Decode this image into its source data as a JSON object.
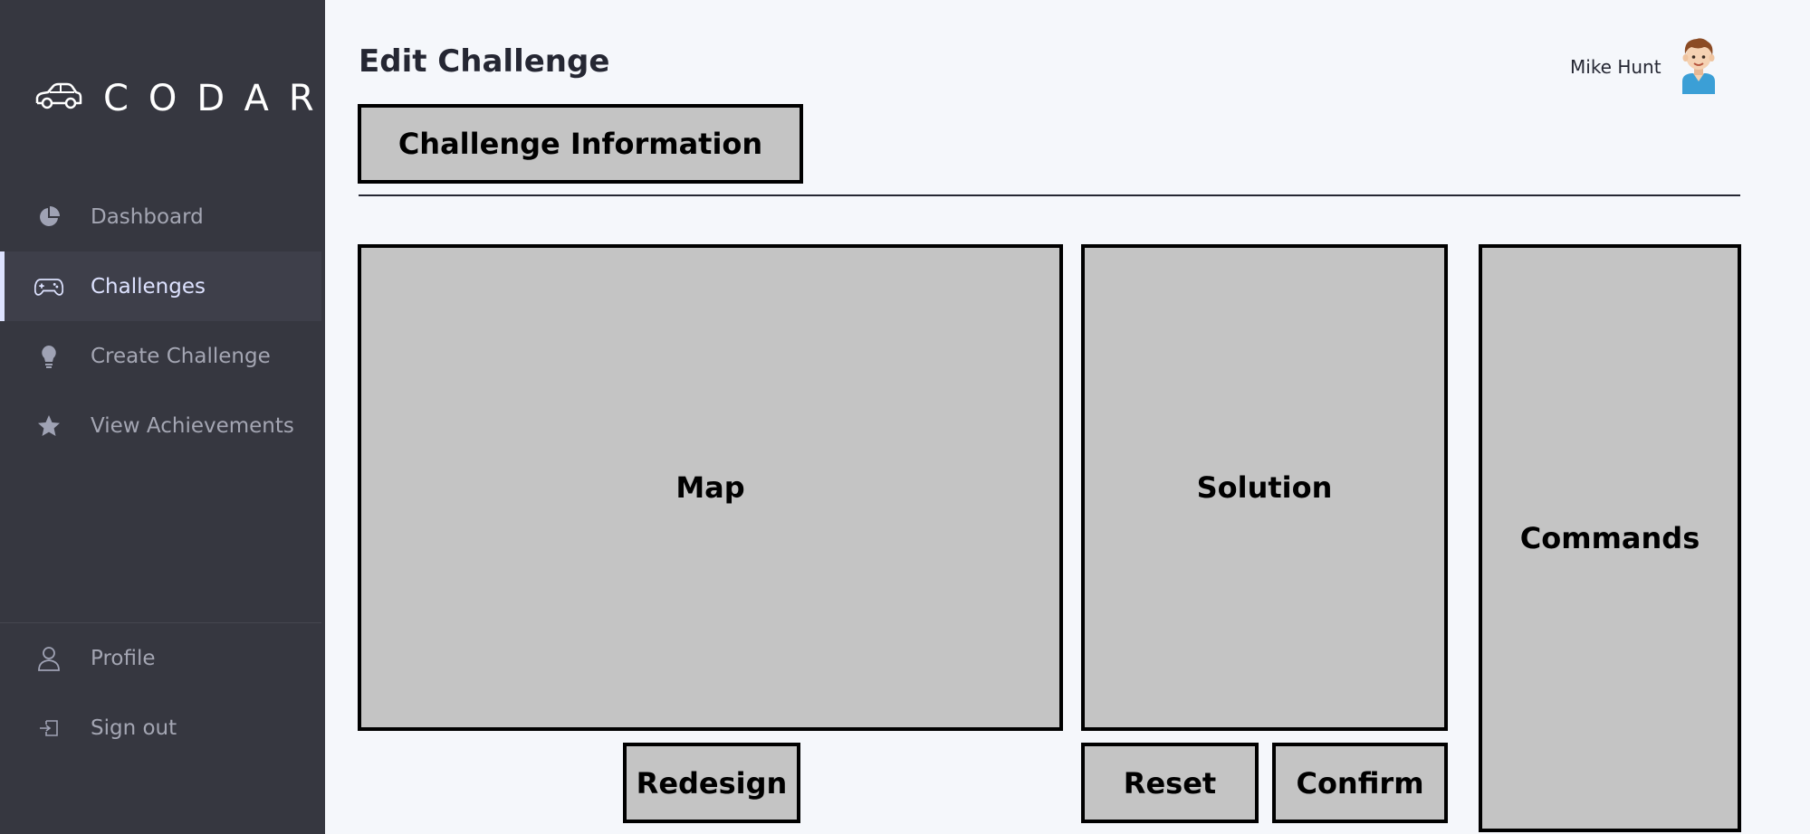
{
  "brand": {
    "name": "CODAR",
    "logo_icon": "car-icon"
  },
  "sidebar": {
    "items": [
      {
        "label": "Dashboard",
        "icon": "pie-chart-icon",
        "active": false
      },
      {
        "label": "Challenges",
        "icon": "gamepad-icon",
        "active": true
      },
      {
        "label": "Create Challenge",
        "icon": "lightbulb-icon",
        "active": false
      },
      {
        "label": "View Achievements",
        "icon": "star-icon",
        "active": false
      }
    ],
    "bottom_items": [
      {
        "label": "Profile",
        "icon": "user-icon"
      },
      {
        "label": "Sign out",
        "icon": "sign-out-icon"
      }
    ]
  },
  "header": {
    "title": "Edit Challenge",
    "user_name": "Mike Hunt"
  },
  "main": {
    "challenge_info_label": "Challenge Information",
    "map_label": "Map",
    "solution_label": "Solution",
    "commands_label": "Commands",
    "redesign_label": "Redesign",
    "reset_label": "Reset",
    "confirm_label": "Confirm"
  },
  "colors": {
    "sidebar_bg": "#363740",
    "page_bg": "#f5f7fb",
    "panel_fill": "#c4c4c4",
    "nav_text": "#a4a6b3",
    "nav_active_text": "#dde2ff"
  }
}
